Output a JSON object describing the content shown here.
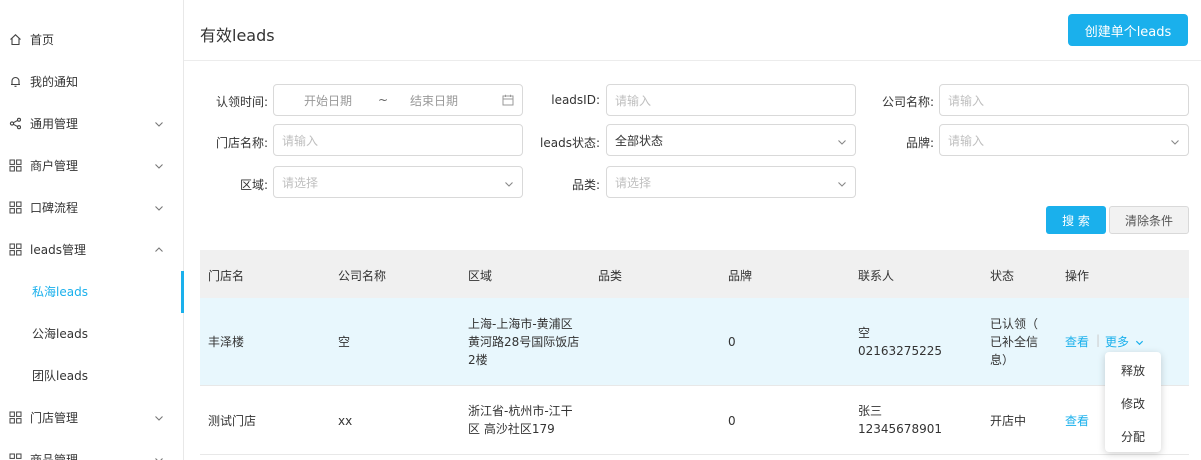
{
  "sidebar": {
    "items": [
      {
        "label": "首页",
        "icon": "home-icon"
      },
      {
        "label": "我的通知",
        "icon": "bell-icon"
      },
      {
        "label": "通用管理",
        "icon": "share-icon"
      },
      {
        "label": "商户管理",
        "icon": "grid-icon"
      },
      {
        "label": "口碑流程",
        "icon": "grid-icon"
      },
      {
        "label": "leads管理",
        "icon": "grid-icon"
      },
      {
        "label": "私海leads"
      },
      {
        "label": "公海leads"
      },
      {
        "label": "团队leads"
      },
      {
        "label": "门店管理",
        "icon": "grid-icon"
      },
      {
        "label": "商品管理",
        "icon": "grid-icon"
      }
    ],
    "active_item": "私海leads"
  },
  "header": {
    "title": "有效leads",
    "create_button": "创建单个leads"
  },
  "filters": {
    "claim_time_label": "认领时间:",
    "start_date_placeholder": "开始日期",
    "date_separator": "~",
    "end_date_placeholder": "结束日期",
    "leads_id_label": "leadsID:",
    "leads_id_placeholder": "请输入",
    "company_label": "公司名称:",
    "company_placeholder": "请输入",
    "store_label": "门店名称:",
    "store_placeholder": "请输入",
    "status_label": "leads状态:",
    "status_value": "全部状态",
    "brand_label": "品牌:",
    "brand_placeholder": "请输入",
    "region_label": "区域:",
    "region_placeholder": "请选择",
    "category_label": "品类:",
    "category_placeholder": "请选择",
    "search_button": "搜 索",
    "clear_button": "清除条件"
  },
  "table": {
    "columns": [
      "门店名",
      "公司名称",
      "区域",
      "品类",
      "品牌",
      "联系人",
      "状态",
      "操作"
    ],
    "rows": [
      {
        "store": "丰泽楼",
        "company": "空",
        "region_line1": "上海-上海市-黄浦区",
        "region_line2": "黄河路28号国际饭店",
        "region_line3": "2楼",
        "category": "",
        "brand": "0",
        "contact_name": "空",
        "contact_phone": "02163275225",
        "status_line1": "已认领（",
        "status_line2": "已补全信",
        "status_line3": "息）",
        "action_view": "查看",
        "action_more": "更多"
      },
      {
        "store": "测试门店",
        "company": "xx",
        "region_line1": "浙江省-杭州市-江干",
        "region_line2": "区 高沙社区179",
        "category": "",
        "brand": "0",
        "contact_name": "张三",
        "contact_phone": "12345678901",
        "status": "开店中",
        "action_view": "查看"
      }
    ]
  },
  "more_menu": {
    "items": [
      "释放",
      "修改",
      "分配"
    ]
  },
  "colors": {
    "accent": "#1ab0ec",
    "row_highlight": "#e8f7fd",
    "header_bg": "#f0f0f0"
  }
}
